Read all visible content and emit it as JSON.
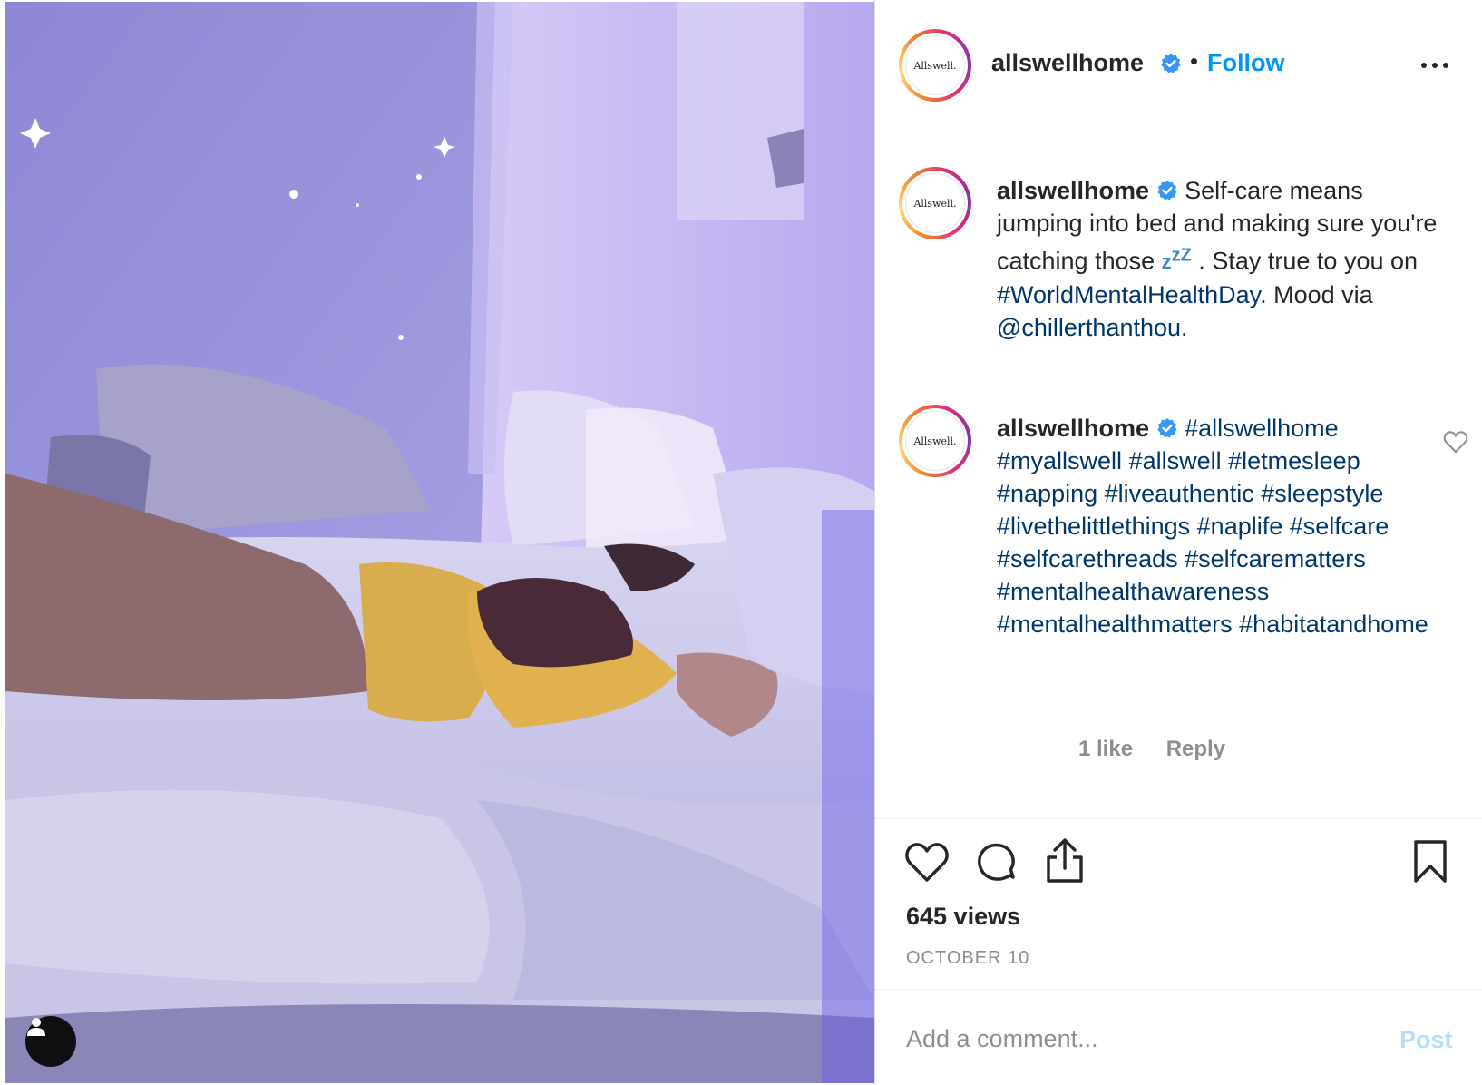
{
  "post": {
    "author": {
      "username": "allswellhome",
      "verified": true,
      "avatar_logo_text": "Allswell."
    },
    "header": {
      "separator": "•",
      "follow_label": "Follow",
      "more_icon": "more-horizontal-icon"
    },
    "caption": {
      "username": "allswellhome",
      "text_1": "Self-care means jumping into bed and making sure you're catching those",
      "zzz_emoji": "z",
      "zzz_emoji_2": "z",
      "zzz_emoji_3": "Z",
      "text_2": ". Stay true to you on",
      "hashtag": "#WorldMentalHealthDay",
      "text_3": ". Mood via",
      "mention": "@chillerthanthou",
      "text_4": "."
    },
    "comment": {
      "username": "allswellhome",
      "hashtags": [
        "#allswellhome",
        "#myallswell",
        "#allswell",
        "#letmesleep",
        "#napping",
        "#liveauthentic",
        "#sleepstyle",
        "#livethelittlethings",
        "#naplife",
        "#selfcare",
        "#selfcarethreads",
        "#selfcarematters",
        "#mentalhealthawareness",
        "#mentalhealthmatters",
        "#habitatandhome"
      ],
      "likes_label": "1 like",
      "reply_label": "Reply"
    },
    "actions": {
      "like_icon": "heart-icon",
      "comment_icon": "comment-bubble-icon",
      "share_icon": "share-upload-icon",
      "save_icon": "bookmark-icon"
    },
    "stats": {
      "views": "645 views",
      "date": "OCTOBER 10"
    },
    "comment_box": {
      "placeholder": "Add a comment...",
      "post_label": "Post"
    }
  },
  "colors": {
    "link_blue": "#0095f6",
    "hashtag_blue": "#00376b",
    "muted_gray": "#8e8e8e",
    "post_disabled": "#b2dffc",
    "verified_blue": "#3897f0"
  }
}
